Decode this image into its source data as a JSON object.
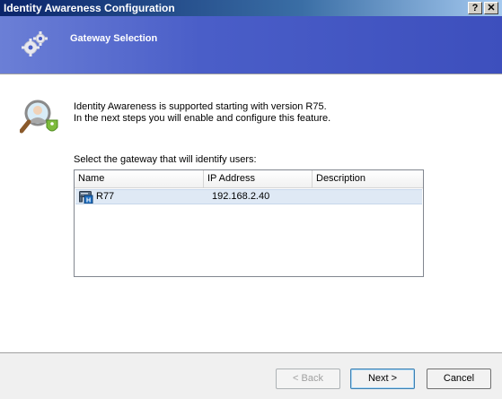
{
  "window": {
    "title": "Identity Awareness Configuration",
    "help_label": "?",
    "close_label": "✕"
  },
  "banner": {
    "heading": "Gateway Selection",
    "icon": "gears-icon"
  },
  "intro": {
    "icon": "identity-magnifier-icon",
    "line1": "Identity Awareness is supported starting with version R75.",
    "line2": "In the next steps you will enable and configure this feature."
  },
  "gateway_list": {
    "label": "Select the gateway that will identify users:",
    "columns": [
      "Name",
      "IP Address",
      "Description"
    ],
    "rows": [
      {
        "icon": "gateway-icon",
        "name": "R77",
        "ip": "192.168.2.40",
        "description": ""
      }
    ]
  },
  "footer": {
    "back_label": "< Back",
    "next_label": "Next >",
    "cancel_label": "Cancel"
  }
}
